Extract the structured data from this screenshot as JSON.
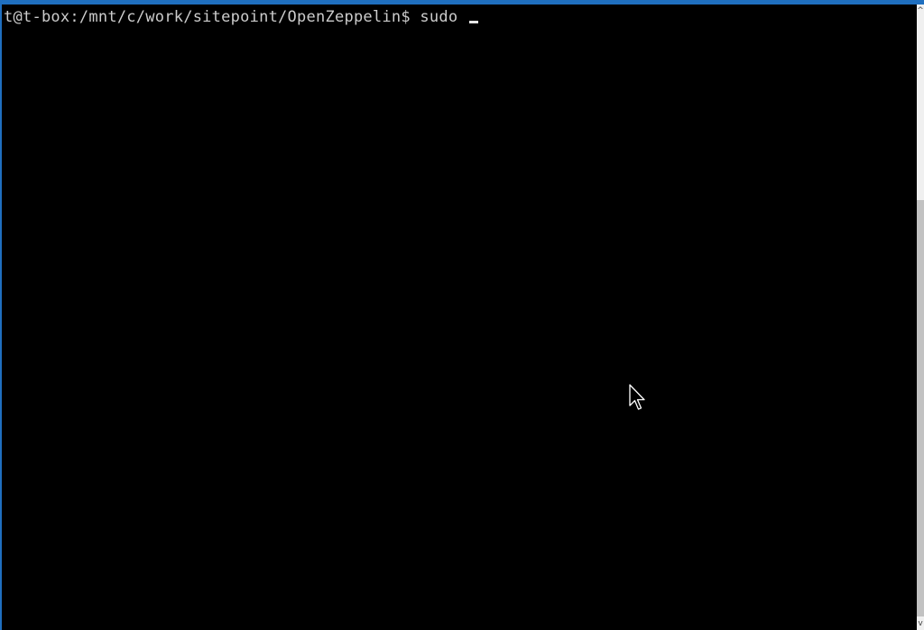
{
  "terminal": {
    "prompt": "t@t-box:/mnt/c/work/sitepoint/OpenZeppelin$",
    "command": "sudo"
  },
  "scrollbar": {
    "up_glyph": "^",
    "down_glyph": "v"
  },
  "colors": {
    "background": "#000000",
    "text": "#cccccc",
    "window_accent": "#1f6fbf"
  },
  "icons": {
    "cursor": "text-cursor-block",
    "pointer": "mouse-pointer-arrow-icon"
  }
}
